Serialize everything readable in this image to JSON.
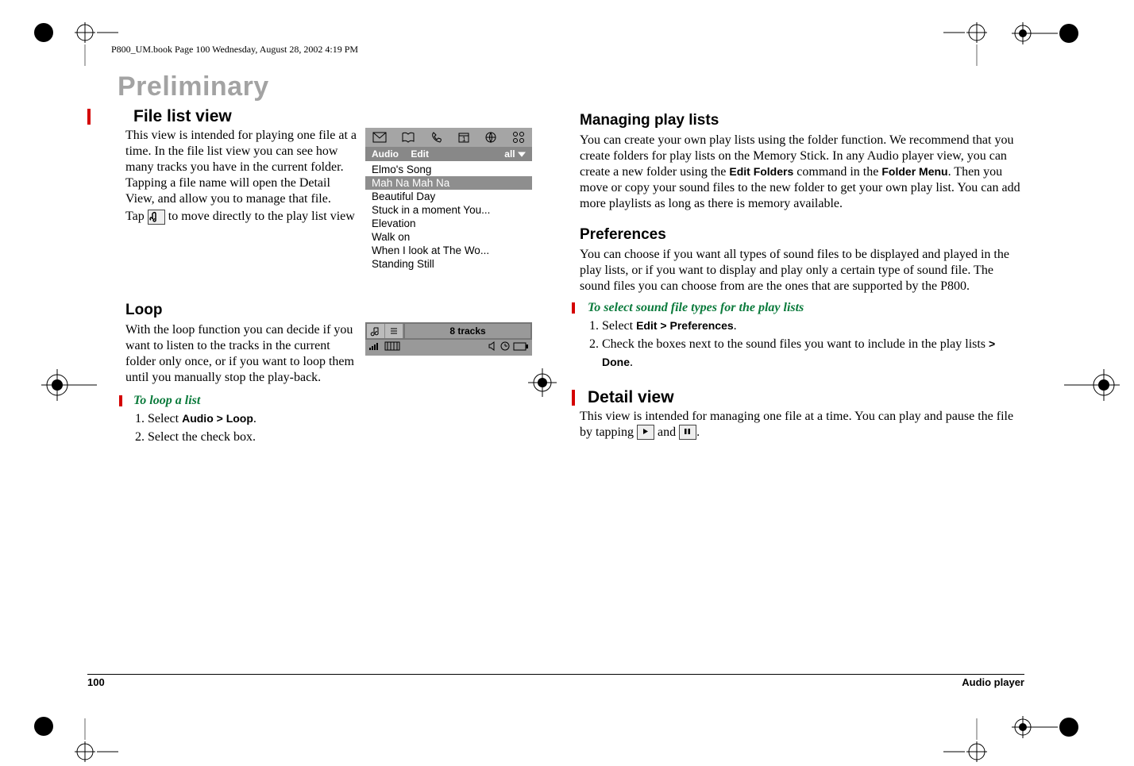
{
  "book_tag": "P800_UM.book  Page 100  Wednesday, August 28, 2002  4:19 PM",
  "watermark": "Preliminary",
  "left": {
    "filelist_heading": " File list view",
    "filelist_para": "This view is intended for playing one file at a time. In the file list view you can see how many tracks you have in the current folder. Tapping a file name will open the Detail View, and allow you to manage that file.",
    "tap_text_pre": "Tap ",
    "tap_text_post": " to move directly to the play list view",
    "loop_heading": "Loop",
    "loop_para": "With the loop function you can decide if you want to listen to the tracks in the current folder only once, or if you want to loop them until you manually stop the play-back.",
    "howto_title": "To loop a list",
    "step1_pre": "Select ",
    "step1_label": "Audio > Loop",
    "step1_post": ".",
    "step2": "Select the check box.",
    "screenshot": {
      "app_menu": "Audio",
      "edit_menu": "Edit",
      "folder": "all",
      "tracks": [
        "Elmo's Song",
        "Mah Na Mah Na",
        "Beautiful Day",
        "Stuck in a moment You...",
        "Elevation",
        "Walk on",
        "When I look at The Wo...",
        "Standing Still"
      ]
    },
    "tracks_bar": "8 tracks"
  },
  "right": {
    "managing_heading": "Managing play lists",
    "managing_para_pre": "You can create your own play lists using the folder function. We recommend that you create folders for play lists on the Memory Stick. In any Audio player view, you can create a new folder using the ",
    "managing_label1": "Edit Folders",
    "managing_mid": " command in the ",
    "managing_label2": "Folder Menu",
    "managing_post": ". Then you move or copy your sound files to the new folder to get your own play list. You can add more playlists as long as there is memory available.",
    "prefs_heading": "Preferences",
    "prefs_para": "You can choose if you want all types of sound files to be displayed and played in the play lists, or if you want to display and play only a certain type of sound file. The sound files you can choose from are the ones that are supported by the P800.",
    "prefs_howto": "To select sound file types for the play lists",
    "prefs_step1_pre": "Select ",
    "prefs_step1_label": "Edit > Preferences",
    "prefs_step1_post": ".",
    "prefs_step2_pre": "Check the boxes next to the sound files you want to include in the play lists ",
    "prefs_step2_label": "> Done",
    "prefs_step2_post": ".",
    "detail_heading": "Detail view",
    "detail_para_pre": "This view is intended for managing one file at a time. You can play and pause the file by tapping ",
    "detail_mid": " and ",
    "detail_post": "."
  },
  "footer": {
    "page": "100",
    "section": "Audio player"
  }
}
